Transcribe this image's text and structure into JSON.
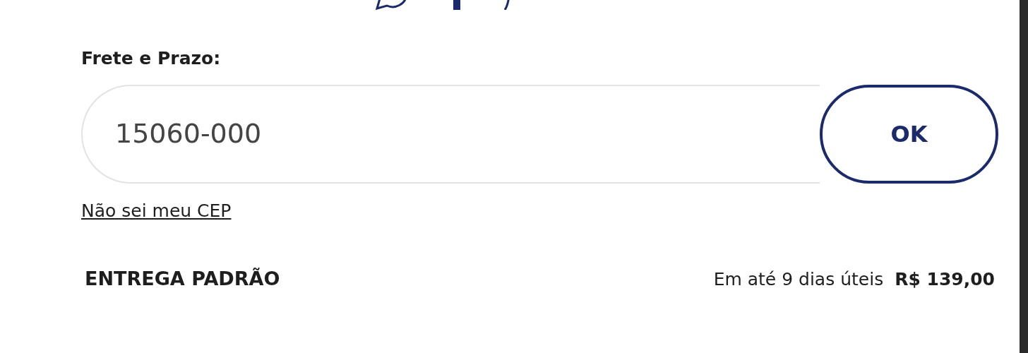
{
  "shipping": {
    "label": "Frete e Prazo:",
    "cep_value": "15060-000",
    "submit": "OK",
    "help_link": "Não sei meu CEP"
  },
  "options": [
    {
      "name": "ENTREGA PADRÃO",
      "deadline": "Em até 9 dias úteis",
      "price": "R$ 139,00"
    }
  ]
}
